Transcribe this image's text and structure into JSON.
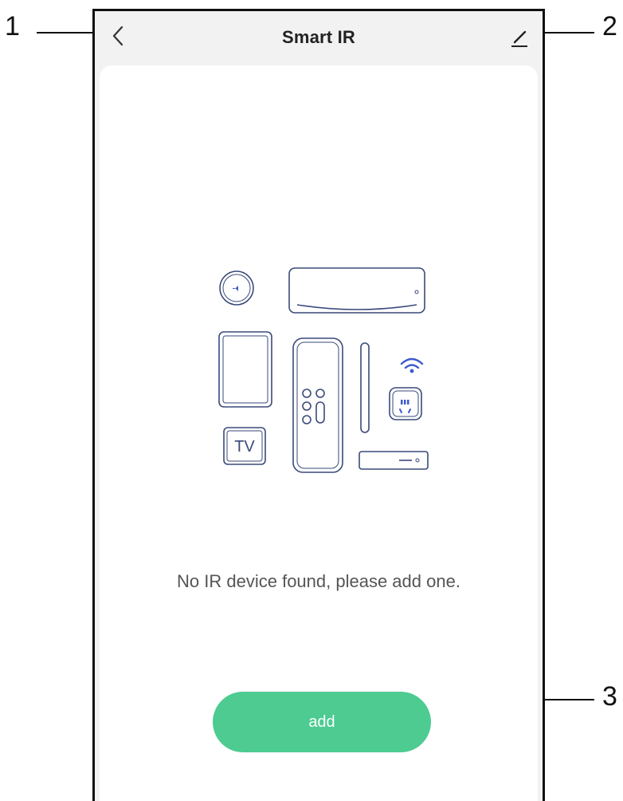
{
  "header": {
    "title": "Smart IR",
    "back_icon": "chevron-left-icon",
    "edit_icon": "pencil-icon"
  },
  "empty_state": {
    "message": "No IR device found,  please add one.",
    "illustration_tv_label": "TV"
  },
  "actions": {
    "add_label": "add"
  },
  "callouts": {
    "one": "1",
    "two": "2",
    "three": "3"
  },
  "colors": {
    "accent": "#4dcb91",
    "icon_blue": "#3b5bcc",
    "outline": "#3a4a7a"
  }
}
